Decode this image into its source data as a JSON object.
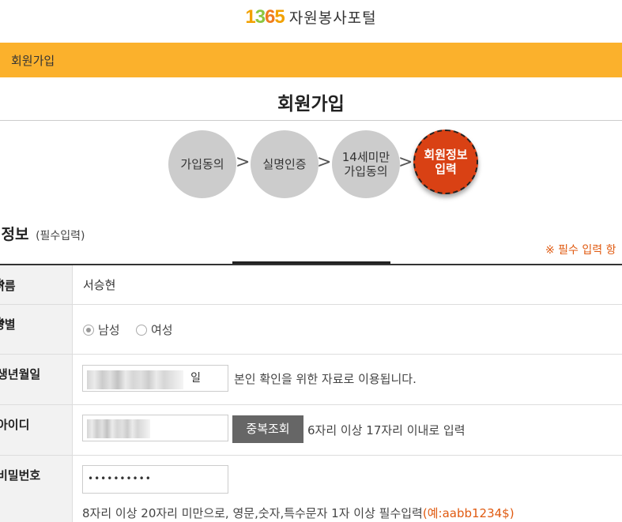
{
  "logo": {
    "n1": "1",
    "n2": "3",
    "n3": "6",
    "n4": "5",
    "text": "자원봉사포털"
  },
  "breadcrumb": "회원가입",
  "page_title": "회원가입",
  "steps": [
    "가입동의",
    "실명인증",
    "14세미만 가입동의",
    "회원정보 입력"
  ],
  "step_labels": {
    "s1": "가입동의",
    "s2": "실명인증",
    "s3a": "14세미만",
    "s3b": "가입동의",
    "s4a": "회원정보",
    "s4b": "입력"
  },
  "arrow": ">",
  "section": {
    "title": "원정보",
    "subtitle": "(필수입력)",
    "required_note": "※ 필수 입력 항"
  },
  "form": {
    "name_label": "이름",
    "name_value": "서승현",
    "gender_label": "성별",
    "gender_options": {
      "male": "남성",
      "female": "여성"
    },
    "gender_selected": "남성",
    "birth_label": "생년월일",
    "birth_suffix": "일",
    "birth_hint": "본인 확인을 위한 자료로 이용됩니다.",
    "id_label": "아이디",
    "id_check_button": "중복조회",
    "id_hint": "6자리 이상 17자리 이내로 입력",
    "pw_label": "비밀번호",
    "pw_value": "••••••••••",
    "pw_hint": "8자리 이상 20자리 미만으로, 영문,숫자,특수문자 1자 이상 필수입력",
    "pw_example": "(예:aabb1234$)"
  },
  "required_mark": "※",
  "colors": {
    "topbar": "#fbb12c",
    "active_step": "#d94114",
    "accent": "#e05a10"
  }
}
